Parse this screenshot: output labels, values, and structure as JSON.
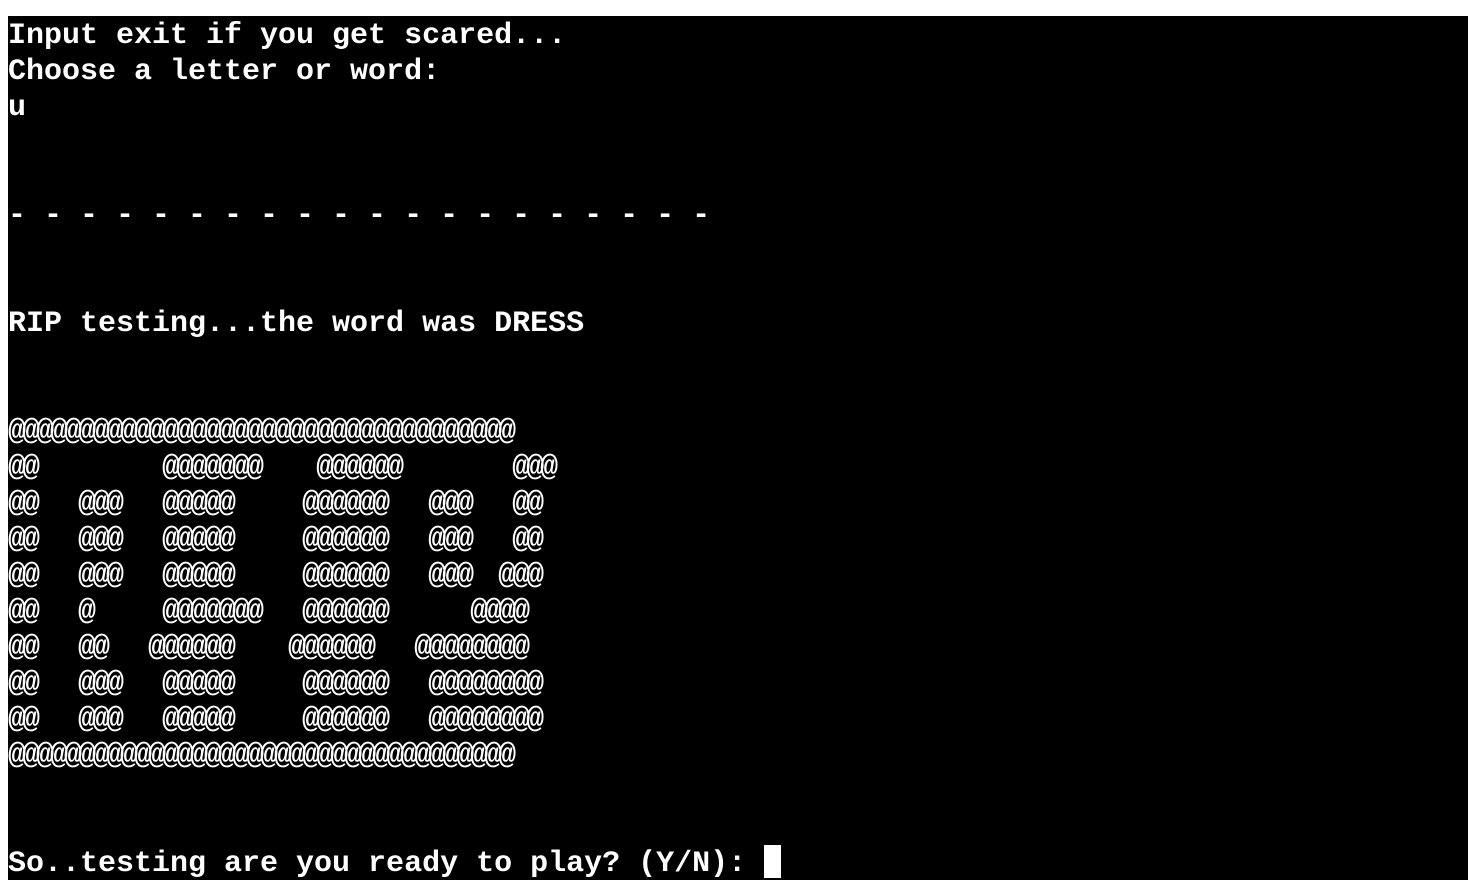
{
  "terminal": {
    "prompt_scared": "Input exit if you get scared...",
    "prompt_choose": "Choose a letter or word:",
    "user_input": "u",
    "word_blanks": "- - - - - - - - - - - - - - - - - - - -",
    "result_message": "RIP testing...the word was DRESS",
    "rip_art": [
      "@@@@@@@@@@@@@@@@@@@@@@@@@@@@@@@@@@@@",
      "@@         @@@@@@@    @@@@@@        @@@",
      "@@   @@@   @@@@@     @@@@@@   @@@   @@",
      "@@   @@@   @@@@@     @@@@@@   @@@   @@",
      "@@   @@@   @@@@@     @@@@@@   @@@  @@@",
      "@@   @     @@@@@@@   @@@@@@      @@@@",
      "@@   @@   @@@@@@    @@@@@@   @@@@@@@@",
      "@@   @@@   @@@@@     @@@@@@   @@@@@@@@",
      "@@   @@@   @@@@@     @@@@@@   @@@@@@@@",
      "@@@@@@@@@@@@@@@@@@@@@@@@@@@@@@@@@@@@"
    ],
    "play_again_prompt": "So..testing are you ready to play? (Y/N): "
  },
  "colors": {
    "background": "#000000",
    "text": "#ffffff",
    "page": "#ffffff"
  }
}
